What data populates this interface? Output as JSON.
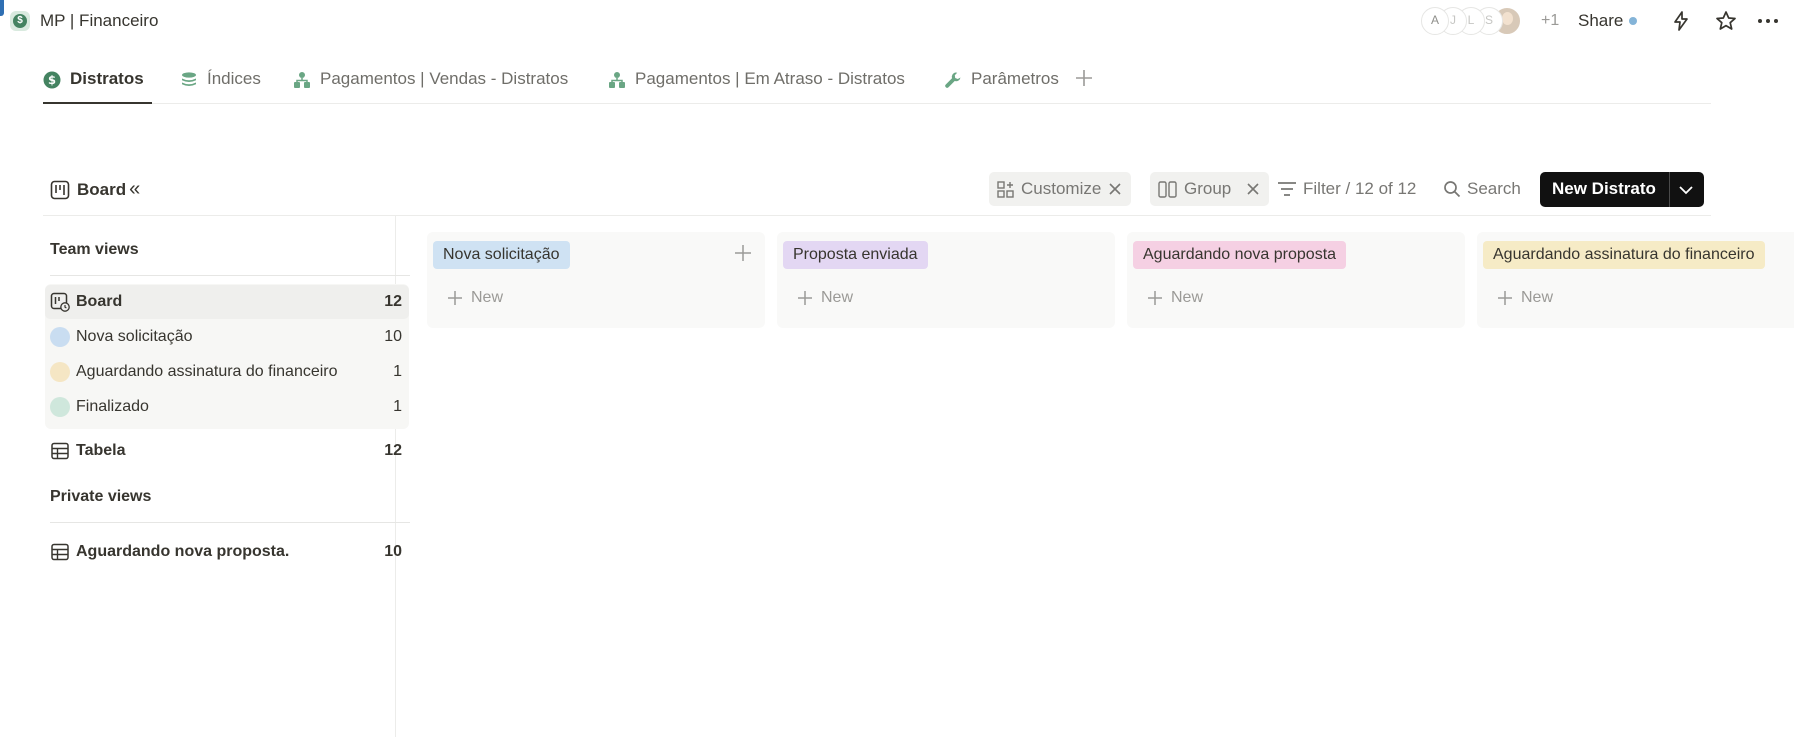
{
  "page": {
    "title": "MP | Financeiro",
    "icon": "dollar-coin-icon"
  },
  "topbar": {
    "avatars": [
      "A",
      "J",
      "L",
      "S"
    ],
    "avatar_more": "+1",
    "share_label": "Share"
  },
  "tabs": [
    {
      "label": "Distratos",
      "icon": "dollar-coin-icon",
      "active": true
    },
    {
      "label": "Índices",
      "icon": "database-icon",
      "active": false
    },
    {
      "label": "Pagamentos | Vendas - Distratos",
      "icon": "hierarchy-icon",
      "active": false
    },
    {
      "label": "Pagamentos | Em Atraso - Distratos",
      "icon": "hierarchy-icon",
      "active": false
    },
    {
      "label": "Parâmetros",
      "icon": "wrench-icon",
      "active": false
    }
  ],
  "viewbar": {
    "current_view": "Board",
    "customize_label": "Customize",
    "group_label": "Group",
    "filter_label": "Filter / 12 of 12",
    "search_label": "Search",
    "new_button_label": "New Distrato"
  },
  "sidebar": {
    "team_views_heading": "Team views",
    "private_views_heading": "Private views",
    "team_views": [
      {
        "label": "Board",
        "count": "12",
        "kind": "board",
        "active": true
      },
      {
        "label": "Nova solicitação",
        "count": "10",
        "kind": "group",
        "color": "#c9ddf1"
      },
      {
        "label": "Aguardando assinatura do financeiro",
        "count": "1",
        "kind": "group",
        "color": "#f5e6c4"
      },
      {
        "label": "Finalizado",
        "count": "1",
        "kind": "group",
        "color": "#cfe7dc"
      },
      {
        "label": "Tabela",
        "count": "12",
        "kind": "table"
      }
    ],
    "private_views": [
      {
        "label": "Aguardando nova proposta.",
        "count": "10",
        "kind": "table"
      }
    ]
  },
  "board": {
    "new_label": "New",
    "columns": [
      {
        "label": "Nova solicitação",
        "color": "#cfe2f3"
      },
      {
        "label": "Proposta enviada",
        "color": "#e3d7f3"
      },
      {
        "label": "Aguardando nova proposta",
        "color": "#f5d0e3"
      },
      {
        "label": "Aguardando assinatura do financeiro",
        "color": "#f6ebc6"
      }
    ]
  }
}
